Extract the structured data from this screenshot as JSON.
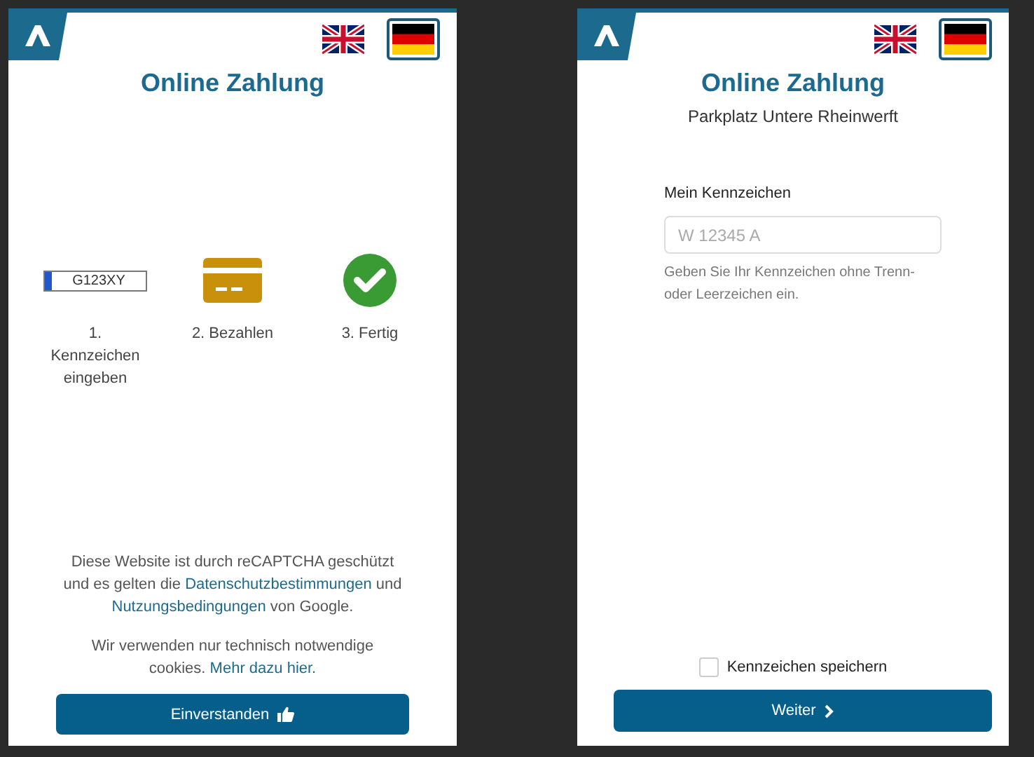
{
  "screens": [
    {
      "languages": [
        {
          "selected": false
        },
        {
          "selected": true
        }
      ],
      "title": "Online Zahlung",
      "steps": [
        {
          "kind": "plate",
          "plate_text": "G123XY",
          "label": "1. Kennzeichen eingeben"
        },
        {
          "kind": "card",
          "label": "2. Bezahlen"
        },
        {
          "kind": "check",
          "label": "3. Fertig"
        }
      ],
      "recaptcha_notice": [
        {
          "text": "Diese Website ist durch reCAPTCHA geschützt und es gelten die",
          "link": false
        },
        {
          "text": "Datenschutzbestimmungen",
          "link": true
        },
        {
          "text": "und",
          "link": false
        },
        {
          "text": "Nutzungsbedingungen",
          "link": true
        },
        {
          "text": "von Google.",
          "link": false
        }
      ],
      "cookie_notice": [
        {
          "text": "Wir verwenden nur technisch notwendige cookies.",
          "link": false
        },
        {
          "text": "Mehr dazu hier.",
          "link": true
        }
      ],
      "button": {
        "label": "Einverstanden",
        "kind": "agree"
      }
    },
    {
      "languages": [
        {
          "selected": false
        },
        {
          "selected": true
        }
      ],
      "title": "Online Zahlung",
      "subtitle": "Parkplatz Untere Rheinwerft",
      "field": {
        "label": "Mein Kennzeichen",
        "placeholder": "W 12345 A",
        "help": "Geben Sie Ihr Kennzeichen ohne Trenn- oder Leerzeichen ein."
      },
      "save_checkbox": {
        "label": "Kennzeichen speichern",
        "checked": false
      },
      "button": {
        "label": "Weiter",
        "kind": "next"
      }
    }
  ]
}
